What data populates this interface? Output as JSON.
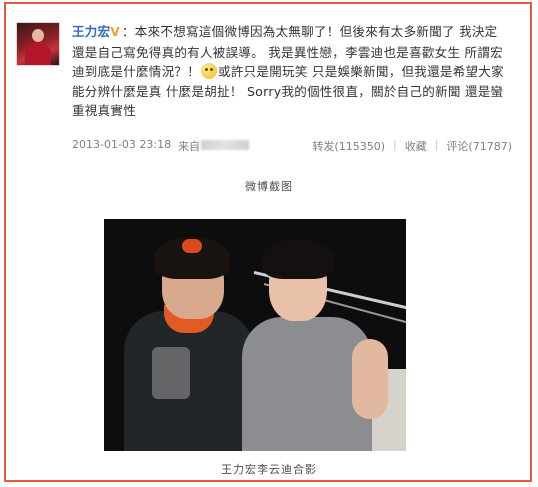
{
  "post": {
    "username": "王力宏",
    "verified_mark": "V",
    "text_1": "：本來不想寫這個微博因為太無聊了！但後來有太多新聞了 我決定還是自己寫免得真的有人被誤導。 我是異性戀，李雲迪也是喜歡女生 所謂宏迪到底是什麼情況？！",
    "emoji_name": "smile-emoji",
    "text_2": "或許只是開玩笑 只是娛樂新聞，但我還是希望大家能分辨什麼是真 什麼是胡扯！ Sorry我的個性很直，關於自己的新聞 還是蠻重視真實性",
    "timestamp": "2013-01-03 23:18",
    "source_label": "来自",
    "repost_label": "转发(115350)",
    "favorite_label": "收藏",
    "comment_label": "评论(71787)",
    "separator": "|"
  },
  "captions": {
    "top": "微博截图",
    "bottom": "王力宏李云迪合影"
  },
  "colors": {
    "frame": "#e8573f",
    "username": "#2e6ab8",
    "verified": "#f3a11b",
    "meta": "#808080"
  }
}
